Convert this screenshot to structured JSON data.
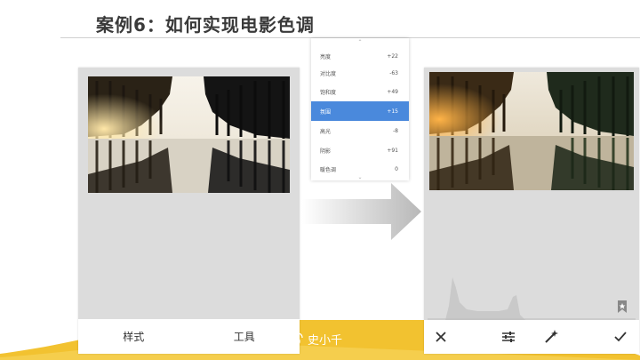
{
  "slide": {
    "title": "案例6：如何实现电影色调"
  },
  "left_app": {
    "tabs": [
      {
        "label": "样式"
      },
      {
        "label": "工具"
      }
    ]
  },
  "adjust_panel": {
    "items": [
      {
        "label": "亮度",
        "value": "+22",
        "active": false
      },
      {
        "label": "对比度",
        "value": "-63",
        "active": false
      },
      {
        "label": "饱和度",
        "value": "+49",
        "active": false
      },
      {
        "label": "氛围",
        "value": "+15",
        "active": true
      },
      {
        "label": "高光",
        "value": "-8",
        "active": false
      },
      {
        "label": "阴影",
        "value": "+91",
        "active": false
      },
      {
        "label": "暖色调",
        "value": "0",
        "active": false
      }
    ]
  },
  "right_app": {
    "toolbar_icons": [
      "close-icon",
      "sliders-icon",
      "magic-wand-icon",
      "check-icon"
    ]
  },
  "watermark": {
    "text": "史小千"
  },
  "colors": {
    "accent": "#4a89dc",
    "wave_yellow": "#f2c230",
    "phone_bg": "#dcdcdc"
  }
}
